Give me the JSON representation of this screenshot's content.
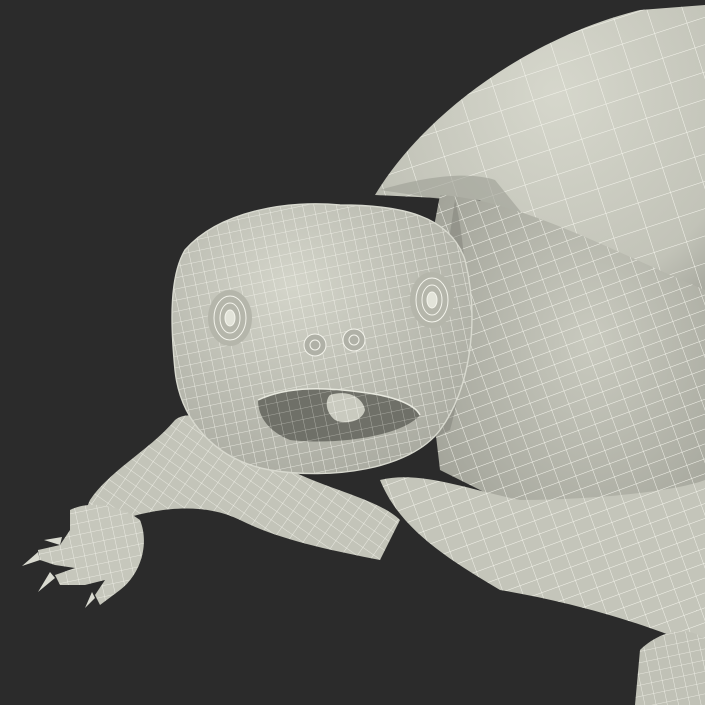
{
  "scene": {
    "subject": "turtle-wireframe-model",
    "colors": {
      "background": "#2b2b2b",
      "surface": "#c8c9be",
      "surface_light": "#dcddd3",
      "surface_shadow": "#8e8f86",
      "wire": "#f4f4ec",
      "mouth": "#6f7068",
      "deep_shadow": "#55564f"
    }
  }
}
